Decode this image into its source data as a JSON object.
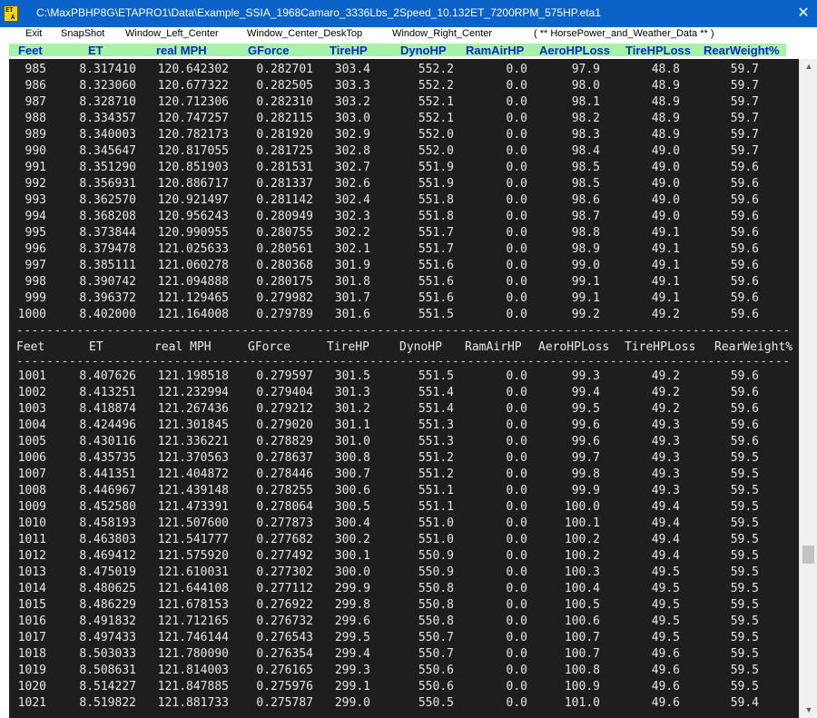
{
  "window": {
    "title": "C:\\MaxPBHP8G\\ETAPRO1\\Data\\Example_SSIA_1968Camaro_3336Lbs_2Speed_10.132ET_7200RPM_575HP.eta1",
    "icon_top": "ET",
    "icon_bottom": "A",
    "close_glyph": "✕"
  },
  "menu": [
    "Exit",
    "SnapShot",
    "Window_Left_Center",
    "Window_Center_DeskTop",
    "Window_Right_Center",
    "( ** HorsePower_and_Weather_Data ** )"
  ],
  "header": {
    "columns": [
      "Feet",
      "ET",
      "real MPH",
      "GForce",
      "TireHP",
      "DynoHP",
      "RamAirHP",
      "AeroHPLoss",
      "TireHPLoss",
      "RearWeight%"
    ]
  },
  "separator": "-----------------------------------------------------------------------------------------------------------",
  "column_header_row": [
    "Feet",
    "ET",
    "real MPH",
    "GForce",
    "TireHP",
    "DynoHP",
    "RamAirHP",
    "AeroHPLoss",
    "TireHPLoss",
    "RearWeight%"
  ],
  "table_top": [
    [
      "985",
      "8.317410",
      "120.642302",
      "0.282701",
      "303.4",
      "552.2",
      "0.0",
      "97.9",
      "48.8",
      "59.7"
    ],
    [
      "986",
      "8.323060",
      "120.677322",
      "0.282505",
      "303.3",
      "552.2",
      "0.0",
      "98.0",
      "48.9",
      "59.7"
    ],
    [
      "987",
      "8.328710",
      "120.712306",
      "0.282310",
      "303.2",
      "552.1",
      "0.0",
      "98.1",
      "48.9",
      "59.7"
    ],
    [
      "988",
      "8.334357",
      "120.747257",
      "0.282115",
      "303.0",
      "552.1",
      "0.0",
      "98.2",
      "48.9",
      "59.7"
    ],
    [
      "989",
      "8.340003",
      "120.782173",
      "0.281920",
      "302.9",
      "552.0",
      "0.0",
      "98.3",
      "48.9",
      "59.7"
    ],
    [
      "990",
      "8.345647",
      "120.817055",
      "0.281725",
      "302.8",
      "552.0",
      "0.0",
      "98.4",
      "49.0",
      "59.7"
    ],
    [
      "991",
      "8.351290",
      "120.851903",
      "0.281531",
      "302.7",
      "551.9",
      "0.0",
      "98.5",
      "49.0",
      "59.6"
    ],
    [
      "992",
      "8.356931",
      "120.886717",
      "0.281337",
      "302.6",
      "551.9",
      "0.0",
      "98.5",
      "49.0",
      "59.6"
    ],
    [
      "993",
      "8.362570",
      "120.921497",
      "0.281142",
      "302.4",
      "551.8",
      "0.0",
      "98.6",
      "49.0",
      "59.6"
    ],
    [
      "994",
      "8.368208",
      "120.956243",
      "0.280949",
      "302.3",
      "551.8",
      "0.0",
      "98.7",
      "49.0",
      "59.6"
    ],
    [
      "995",
      "8.373844",
      "120.990955",
      "0.280755",
      "302.2",
      "551.7",
      "0.0",
      "98.8",
      "49.1",
      "59.6"
    ],
    [
      "996",
      "8.379478",
      "121.025633",
      "0.280561",
      "302.1",
      "551.7",
      "0.0",
      "98.9",
      "49.1",
      "59.6"
    ],
    [
      "997",
      "8.385111",
      "121.060278",
      "0.280368",
      "301.9",
      "551.6",
      "0.0",
      "99.0",
      "49.1",
      "59.6"
    ],
    [
      "998",
      "8.390742",
      "121.094888",
      "0.280175",
      "301.8",
      "551.6",
      "0.0",
      "99.1",
      "49.1",
      "59.6"
    ],
    [
      "999",
      "8.396372",
      "121.129465",
      "0.279982",
      "301.7",
      "551.6",
      "0.0",
      "99.1",
      "49.1",
      "59.6"
    ],
    [
      "1000",
      "8.402000",
      "121.164008",
      "0.279789",
      "301.6",
      "551.5",
      "0.0",
      "99.2",
      "49.2",
      "59.6"
    ]
  ],
  "table_bottom": [
    [
      "1001",
      "8.407626",
      "121.198518",
      "0.279597",
      "301.5",
      "551.5",
      "0.0",
      "99.3",
      "49.2",
      "59.6"
    ],
    [
      "1002",
      "8.413251",
      "121.232994",
      "0.279404",
      "301.3",
      "551.4",
      "0.0",
      "99.4",
      "49.2",
      "59.6"
    ],
    [
      "1003",
      "8.418874",
      "121.267436",
      "0.279212",
      "301.2",
      "551.4",
      "0.0",
      "99.5",
      "49.2",
      "59.6"
    ],
    [
      "1004",
      "8.424496",
      "121.301845",
      "0.279020",
      "301.1",
      "551.3",
      "0.0",
      "99.6",
      "49.3",
      "59.6"
    ],
    [
      "1005",
      "8.430116",
      "121.336221",
      "0.278829",
      "301.0",
      "551.3",
      "0.0",
      "99.6",
      "49.3",
      "59.6"
    ],
    [
      "1006",
      "8.435735",
      "121.370563",
      "0.278637",
      "300.8",
      "551.2",
      "0.0",
      "99.7",
      "49.3",
      "59.5"
    ],
    [
      "1007",
      "8.441351",
      "121.404872",
      "0.278446",
      "300.7",
      "551.2",
      "0.0",
      "99.8",
      "49.3",
      "59.5"
    ],
    [
      "1008",
      "8.446967",
      "121.439148",
      "0.278255",
      "300.6",
      "551.1",
      "0.0",
      "99.9",
      "49.3",
      "59.5"
    ],
    [
      "1009",
      "8.452580",
      "121.473391",
      "0.278064",
      "300.5",
      "551.1",
      "0.0",
      "100.0",
      "49.4",
      "59.5"
    ],
    [
      "1010",
      "8.458193",
      "121.507600",
      "0.277873",
      "300.4",
      "551.0",
      "0.0",
      "100.1",
      "49.4",
      "59.5"
    ],
    [
      "1011",
      "8.463803",
      "121.541777",
      "0.277682",
      "300.2",
      "551.0",
      "0.0",
      "100.2",
      "49.4",
      "59.5"
    ],
    [
      "1012",
      "8.469412",
      "121.575920",
      "0.277492",
      "300.1",
      "550.9",
      "0.0",
      "100.2",
      "49.4",
      "59.5"
    ],
    [
      "1013",
      "8.475019",
      "121.610031",
      "0.277302",
      "300.0",
      "550.9",
      "0.0",
      "100.3",
      "49.5",
      "59.5"
    ],
    [
      "1014",
      "8.480625",
      "121.644108",
      "0.277112",
      "299.9",
      "550.8",
      "0.0",
      "100.4",
      "49.5",
      "59.5"
    ],
    [
      "1015",
      "8.486229",
      "121.678153",
      "0.276922",
      "299.8",
      "550.8",
      "0.0",
      "100.5",
      "49.5",
      "59.5"
    ],
    [
      "1016",
      "8.491832",
      "121.712165",
      "0.276732",
      "299.6",
      "550.8",
      "0.0",
      "100.6",
      "49.5",
      "59.5"
    ],
    [
      "1017",
      "8.497433",
      "121.746144",
      "0.276543",
      "299.5",
      "550.7",
      "0.0",
      "100.7",
      "49.5",
      "59.5"
    ],
    [
      "1018",
      "8.503033",
      "121.780090",
      "0.276354",
      "299.4",
      "550.7",
      "0.0",
      "100.7",
      "49.6",
      "59.5"
    ],
    [
      "1019",
      "8.508631",
      "121.814003",
      "0.276165",
      "299.3",
      "550.6",
      "0.0",
      "100.8",
      "49.6",
      "59.5"
    ],
    [
      "1020",
      "8.514227",
      "121.847885",
      "0.275976",
      "299.1",
      "550.6",
      "0.0",
      "100.9",
      "49.6",
      "59.5"
    ],
    [
      "1021",
      "8.519822",
      "121.881733",
      "0.275787",
      "299.0",
      "550.5",
      "0.0",
      "101.0",
      "49.6",
      "59.4"
    ]
  ],
  "scrollbar": {
    "up_glyph": "▲",
    "down_glyph": "▼"
  }
}
